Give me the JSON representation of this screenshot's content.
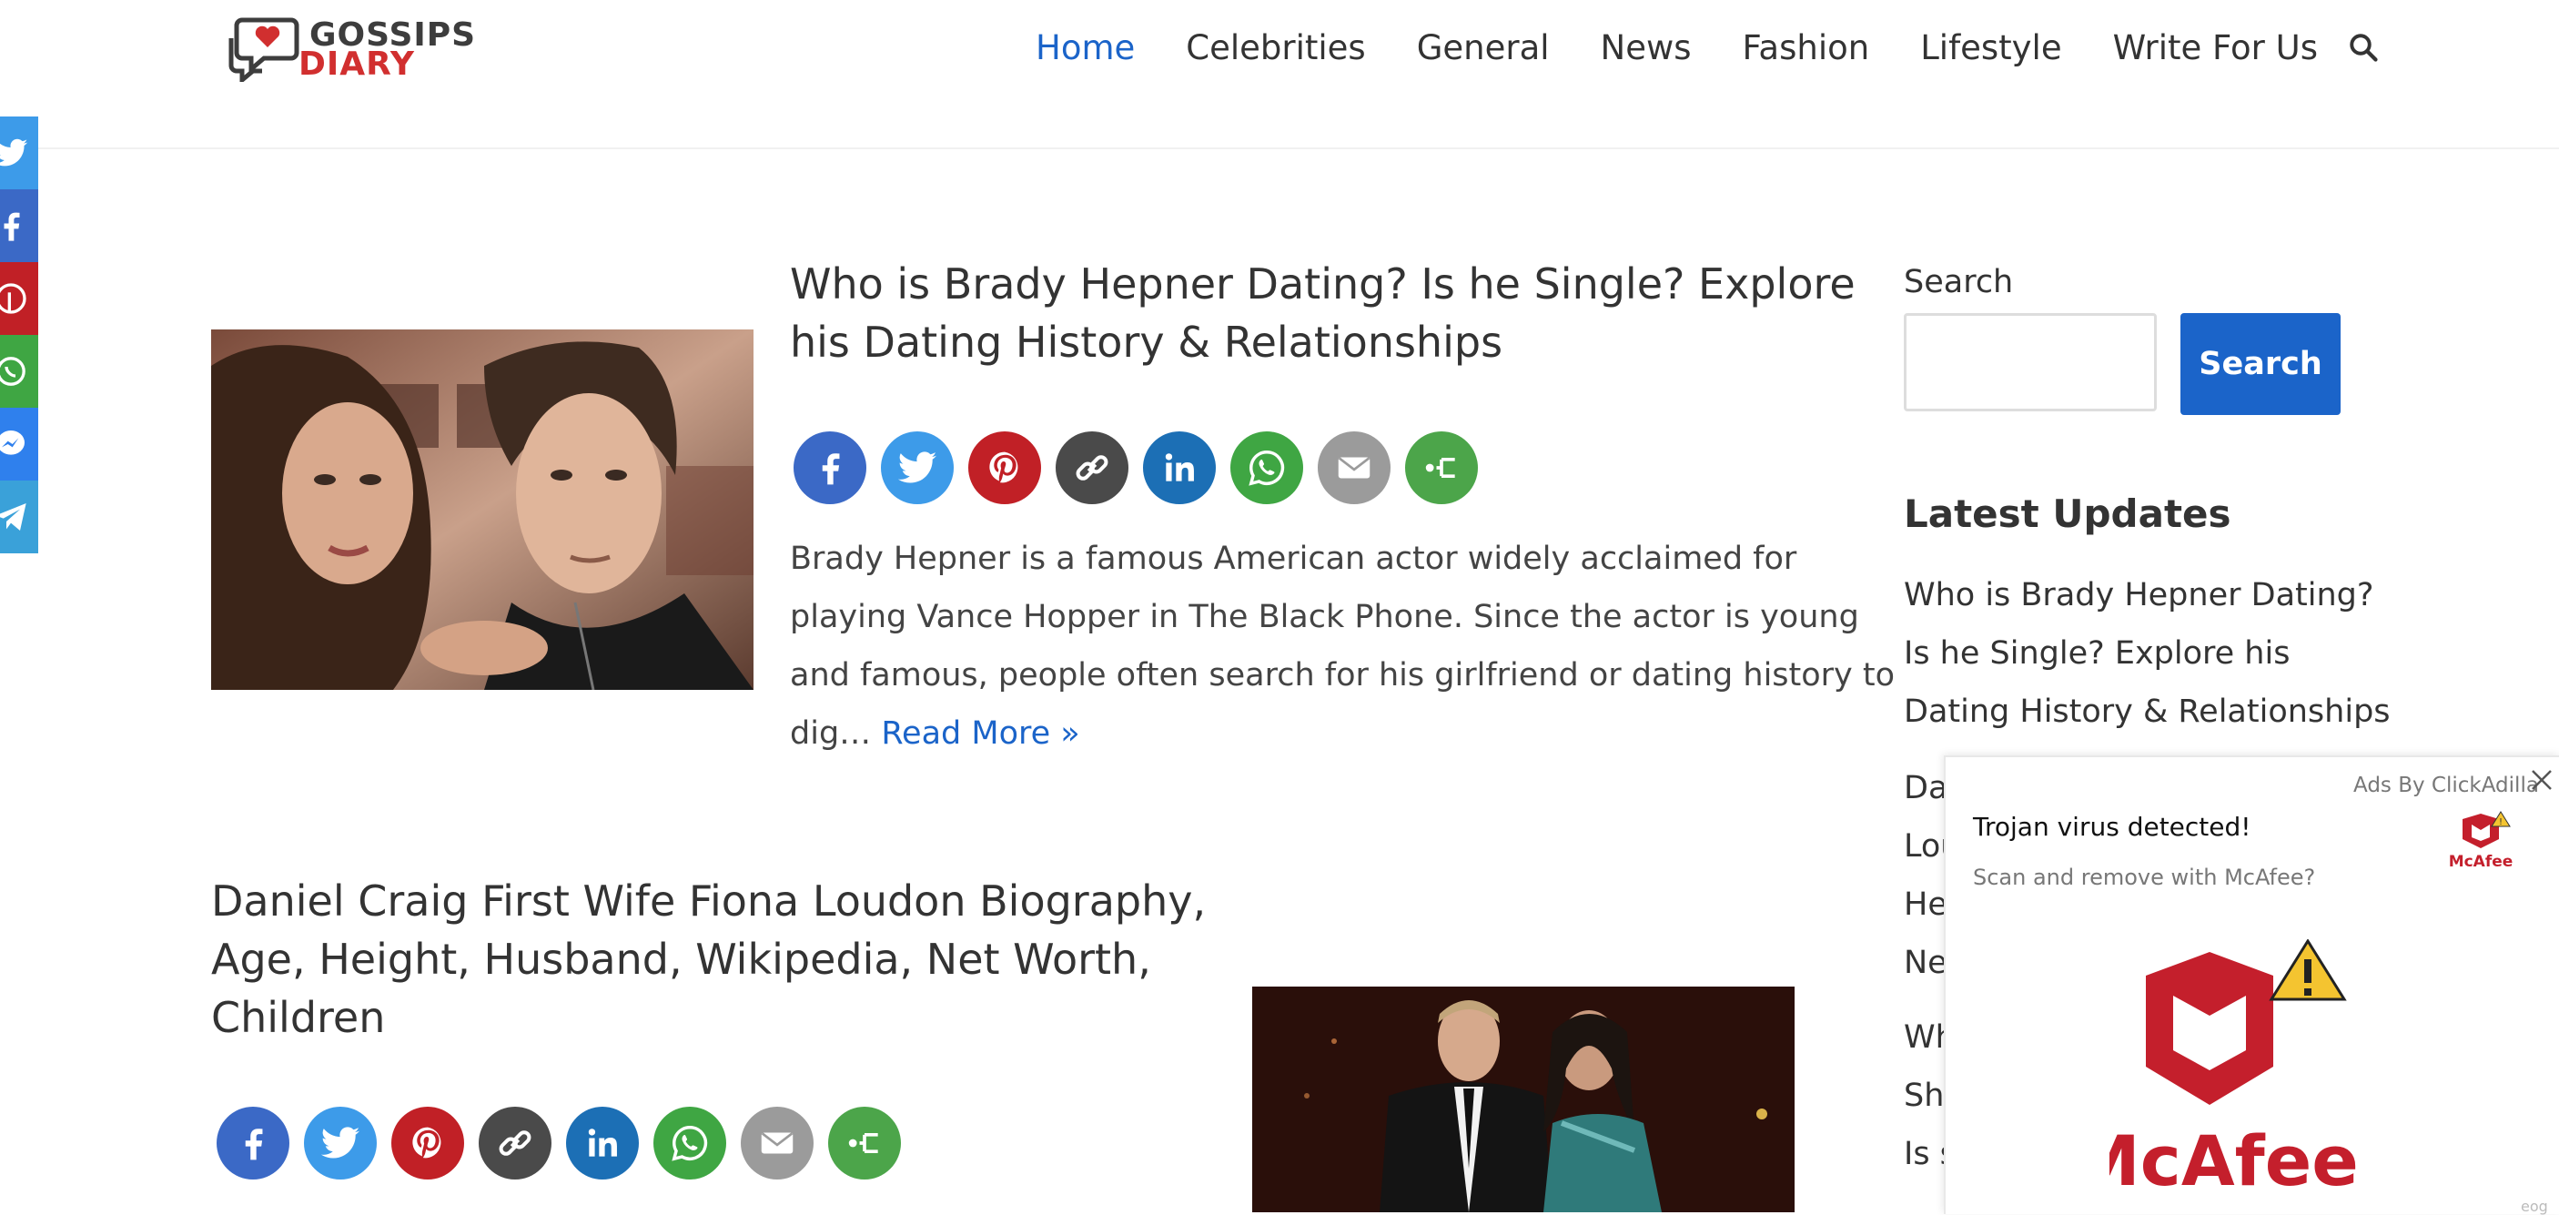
{
  "logo": {
    "line1": "GOSSIPS",
    "line2": "DIARY"
  },
  "nav": {
    "items": [
      "Home",
      "Celebrities",
      "General",
      "News",
      "Fashion",
      "Lifestyle",
      "Write For Us"
    ],
    "active": "Home"
  },
  "social_bar": [
    "twitter-icon",
    "facebook-icon",
    "pinterest-icon",
    "whatsapp-icon",
    "messenger-icon",
    "telegram-icon"
  ],
  "posts": [
    {
      "title": "Who is Brady Hepner Dating? Is he Single? Explore his Dating History & Relationships",
      "title_lines": [
        "Who is Brady Hepner Dating? Is he Single? Explore",
        "his Dating History & Relationships"
      ],
      "excerpt_lines": [
        "Brady Hepner is a famous American actor widely acclaimed for",
        "playing Vance Hopper in The Black Phone. Since the actor is young",
        "and famous, people often search for his girlfriend or dating history to",
        "dig…"
      ],
      "read_more": "Read More »"
    },
    {
      "title": "Daniel Craig First Wife Fiona Loudon Biography, Age, Height, Husband, Wikipedia, Net Worth, Children",
      "title_lines": [
        "Daniel Craig First Wife Fiona Loudon Biography,",
        "Age, Height, Husband, Wikipedia, Net Worth,",
        "Children"
      ]
    }
  ],
  "share_buttons": [
    "facebook",
    "twitter",
    "pinterest",
    "copy-link",
    "linkedin",
    "whatsapp",
    "email",
    "more"
  ],
  "sidebar": {
    "search_label": "Search",
    "search_button": "Search",
    "latest_heading": "Latest Updates",
    "latest_lines": [
      "Who is Brady Hepner Dating?",
      "Is he Single? Explore his",
      "Dating History & Relationships",
      "Da",
      "Lou",
      "He",
      "Ne",
      "Wh",
      "She",
      "Is s"
    ]
  },
  "ad": {
    "by": "Ads By ClickAdilla",
    "title": "Trojan virus detected!",
    "subtitle": "Scan and remove with McAfee?",
    "brand": "McAfee",
    "corner": "eog"
  },
  "colors": {
    "accent": "#1b64c9",
    "facebook": "#3b69c6",
    "twitter": "#3d9be9",
    "pinterest": "#c12026",
    "copy": "#4a4a4a",
    "linkedin": "#1c6fb5",
    "whatsapp": "#3fa643",
    "email": "#9b9b9b",
    "more": "#4ca54a",
    "mcafee": "#c41f2c"
  }
}
